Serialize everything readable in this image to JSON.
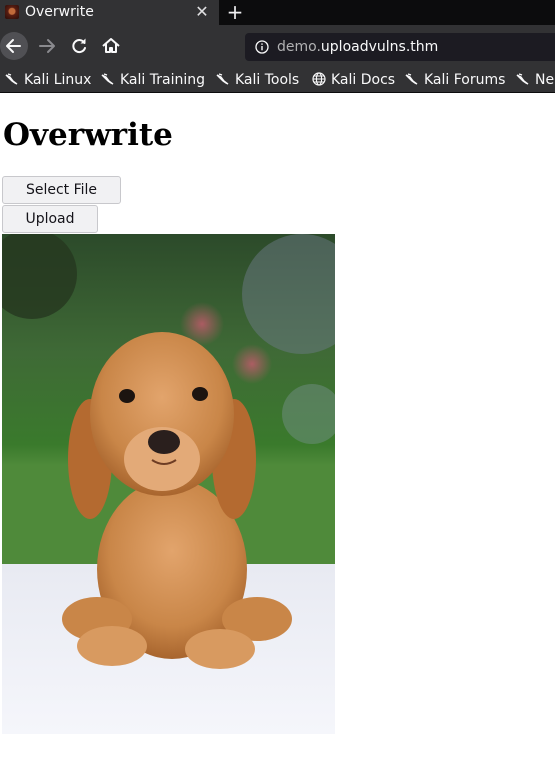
{
  "browser": {
    "tab": {
      "title": "Overwrite",
      "close_glyph": "✕"
    },
    "new_tab_glyph": "+",
    "nav": {
      "back": "←",
      "forward": "→",
      "reload": "↻",
      "home": "⌂"
    },
    "url": {
      "prefix": "demo.",
      "domain": "uploadvulns.thm"
    },
    "bookmarks": [
      {
        "label": "Kali Linux",
        "icon": "kali-dragon-icon"
      },
      {
        "label": "Kali Training",
        "icon": "kali-dragon-icon"
      },
      {
        "label": "Kali Tools",
        "icon": "kali-dragon-icon"
      },
      {
        "label": "Kali Docs",
        "icon": "globe-icon"
      },
      {
        "label": "Kali Forums",
        "icon": "kali-dragon-icon"
      },
      {
        "label": "Ne",
        "icon": "kali-dragon-icon"
      }
    ]
  },
  "page": {
    "heading": "Overwrite",
    "select_file_label": "Select File",
    "upload_label": "Upload",
    "image": {
      "subject": "puppy photo"
    }
  },
  "colors": {
    "chrome_bg": "#323234",
    "tabstrip_bg": "#0c0c0d",
    "urlbar_bg": "#1c1b22"
  }
}
